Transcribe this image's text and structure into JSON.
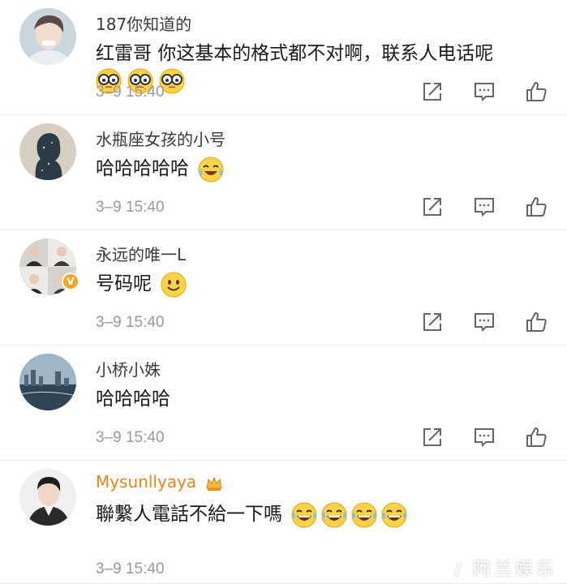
{
  "comments": [
    {
      "username": "187你知道的",
      "text": "红雷哥  你这基本的格式都不对啊，联系人电话呢",
      "emoji": "glasses-emoji",
      "time": "3–9 15:40"
    },
    {
      "username": "水瓶座女孩的小号",
      "text": "哈哈哈哈哈",
      "emoji": "laugh-cry-emoji",
      "time": "3–9 15:40"
    },
    {
      "username": "永远的唯一L",
      "text": "号码呢",
      "emoji": "smile-emoji",
      "time": "3–9 15:40",
      "verified": "V"
    },
    {
      "username": "小桥小姝",
      "text": "哈哈哈哈",
      "time": "3–9 15:40"
    },
    {
      "username": "Mysunllyaya",
      "text": "聯繫人電話不給一下嗎",
      "emoji": "laugh-tears-emoji",
      "time": "3–9 15:40"
    }
  ],
  "watermark": "/ 阿兰娱乐",
  "colors": {
    "vip_name": "#e8841a",
    "time_gray": "#9a9a9a",
    "badge": "#f5a623"
  }
}
